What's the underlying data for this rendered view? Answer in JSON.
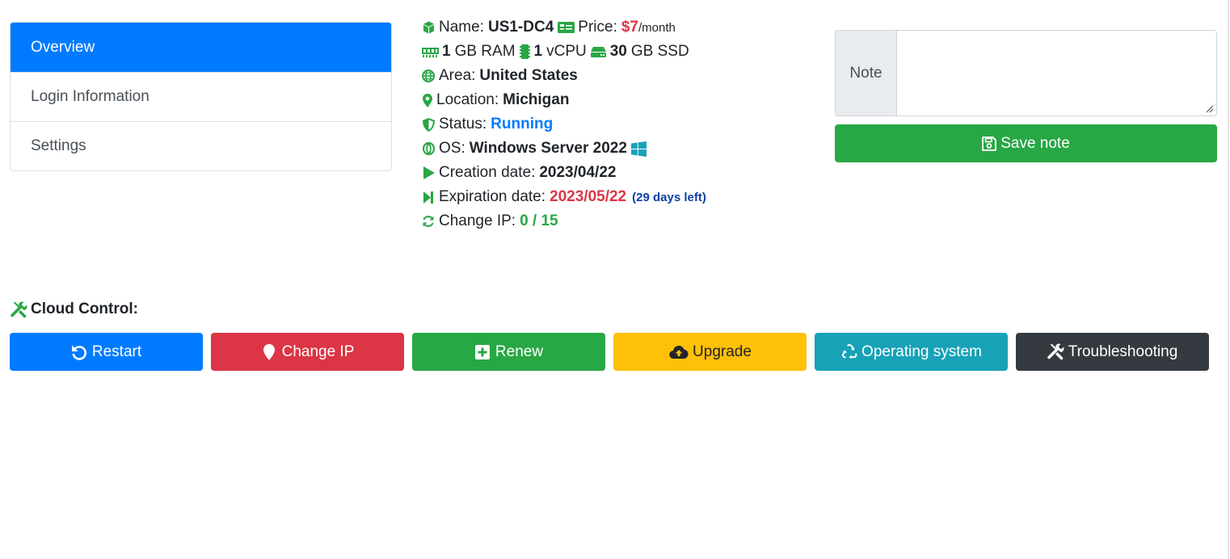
{
  "nav": {
    "items": [
      {
        "label": "Overview",
        "active": true
      },
      {
        "label": "Login Information",
        "active": false
      },
      {
        "label": "Settings",
        "active": false
      }
    ]
  },
  "info": {
    "name_label": "Name:",
    "name_value": "US1-DC4",
    "price_label": "Price:",
    "price_value": "$7",
    "price_period": "/month",
    "ram_value": "1",
    "ram_unit": "GB RAM",
    "cpu_value": "1",
    "cpu_unit": "vCPU",
    "ssd_value": "30",
    "ssd_unit": "GB SSD",
    "area_label": "Area:",
    "area_value": "United States",
    "location_label": "Location:",
    "location_value": "Michigan",
    "status_label": "Status:",
    "status_value": "Running",
    "os_label": "OS:",
    "os_value": "Windows Server 2022",
    "creation_label": "Creation date:",
    "creation_value": "2023/04/22",
    "expiration_label": "Expiration date:",
    "expiration_value": "2023/05/22",
    "days_left": "(29 days left)",
    "change_ip_label": "Change IP:",
    "change_ip_value": "0 / 15"
  },
  "note": {
    "label": "Note",
    "value": "",
    "save_label": "Save note"
  },
  "cloud_control": {
    "title": "Cloud Control:",
    "buttons": {
      "restart": "Restart",
      "change_ip": "Change IP",
      "renew": "Renew",
      "upgrade": "Upgrade",
      "operating_system": "Operating system",
      "troubleshooting": "Troubleshooting"
    }
  },
  "colors": {
    "primary": "#007bff",
    "danger": "#dc3545",
    "success": "#28a745",
    "warning": "#ffc107",
    "info": "#17a2b8",
    "dark": "#343a40"
  },
  "icons": {
    "name": "cube-icon",
    "price": "money-bill-icon",
    "ram": "memory-icon",
    "cpu": "microchip-icon",
    "ssd": "hdd-icon",
    "area": "globe-icon",
    "location": "map-marker-icon",
    "status": "shield-icon",
    "os": "opera-icon",
    "os_brand": "windows-icon",
    "creation": "play-icon",
    "expiration": "step-forward-icon",
    "change_ip": "sync-icon",
    "save": "save-icon",
    "cloud_control": "tools-icon",
    "restart": "undo-icon",
    "change_ip_btn": "map-marker-icon",
    "renew": "plus-square-icon",
    "upgrade": "cloud-upload-icon",
    "operating_system": "recycle-icon",
    "troubleshooting": "tools-icon"
  }
}
